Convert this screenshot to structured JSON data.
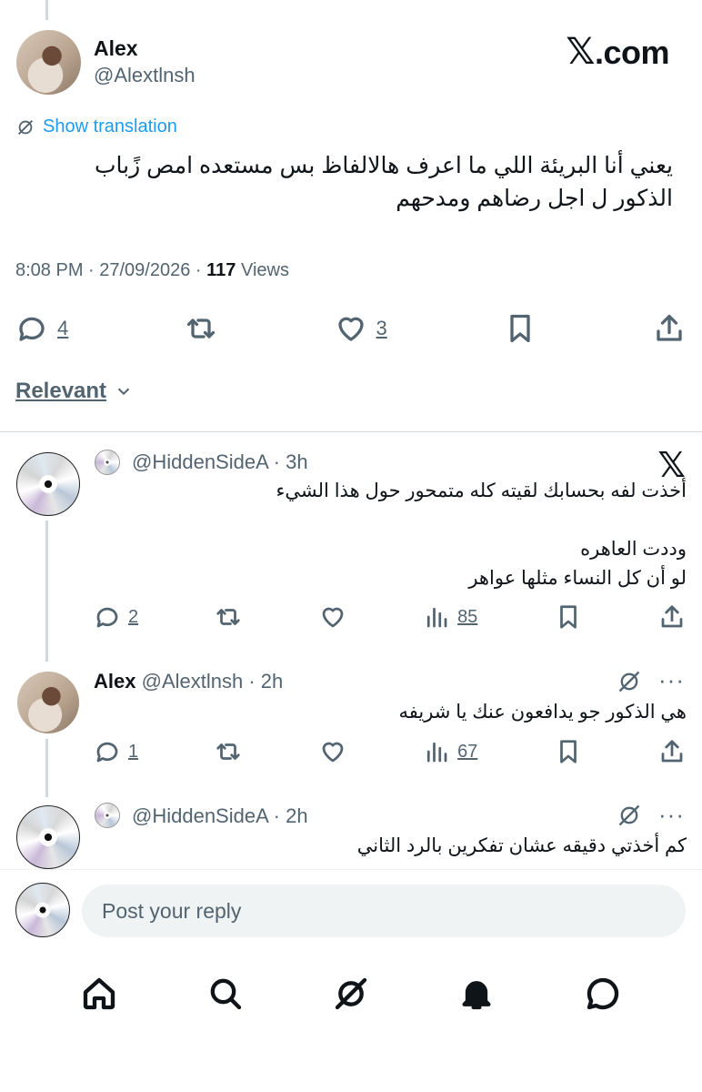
{
  "header": {
    "name": "Alex",
    "handle": "@Alextlnsh",
    "brand": ".com",
    "brand_glyph": "𝕏"
  },
  "main_tweet": {
    "translate_label": "Show translation",
    "text_line1": "يعني أنا البريئة اللي ما اعرف هالالفاظ بس مستعده امص زًباب",
    "text_line2": "الذكور ل اجل رضاهم ومدحهم",
    "time": "8:08 PM · 27/09/2026 · ",
    "views_count": "117",
    "views_label": " Views",
    "reply_count": "4",
    "like_count": "3"
  },
  "sort": {
    "label": "Relevant"
  },
  "replies": [
    {
      "handle": "@HiddenSideA",
      "time": "· 3h",
      "text_lines": [
        "أخذت لفه بحسابك لقيته كله متمحور حول هذا الشيء",
        "",
        "وددت العاهره",
        "لو أن كل النساء مثلها عواهر"
      ],
      "reply_count": "2",
      "views": "85",
      "x_glyph": "𝕏"
    },
    {
      "name": "Alex",
      "handle": "@Alextlnsh",
      "time": "· 2h",
      "text": "هي الذكور جو يدافعون عنك يا شريفه",
      "reply_count": "1",
      "views": "67",
      "more": "···"
    },
    {
      "handle": "@HiddenSideA",
      "time": "· 2h",
      "text": "كم أخذتي دقيقه عشان تفكرين بالرد الثاني",
      "more": "···"
    }
  ],
  "composer": {
    "placeholder": "Post your reply"
  }
}
